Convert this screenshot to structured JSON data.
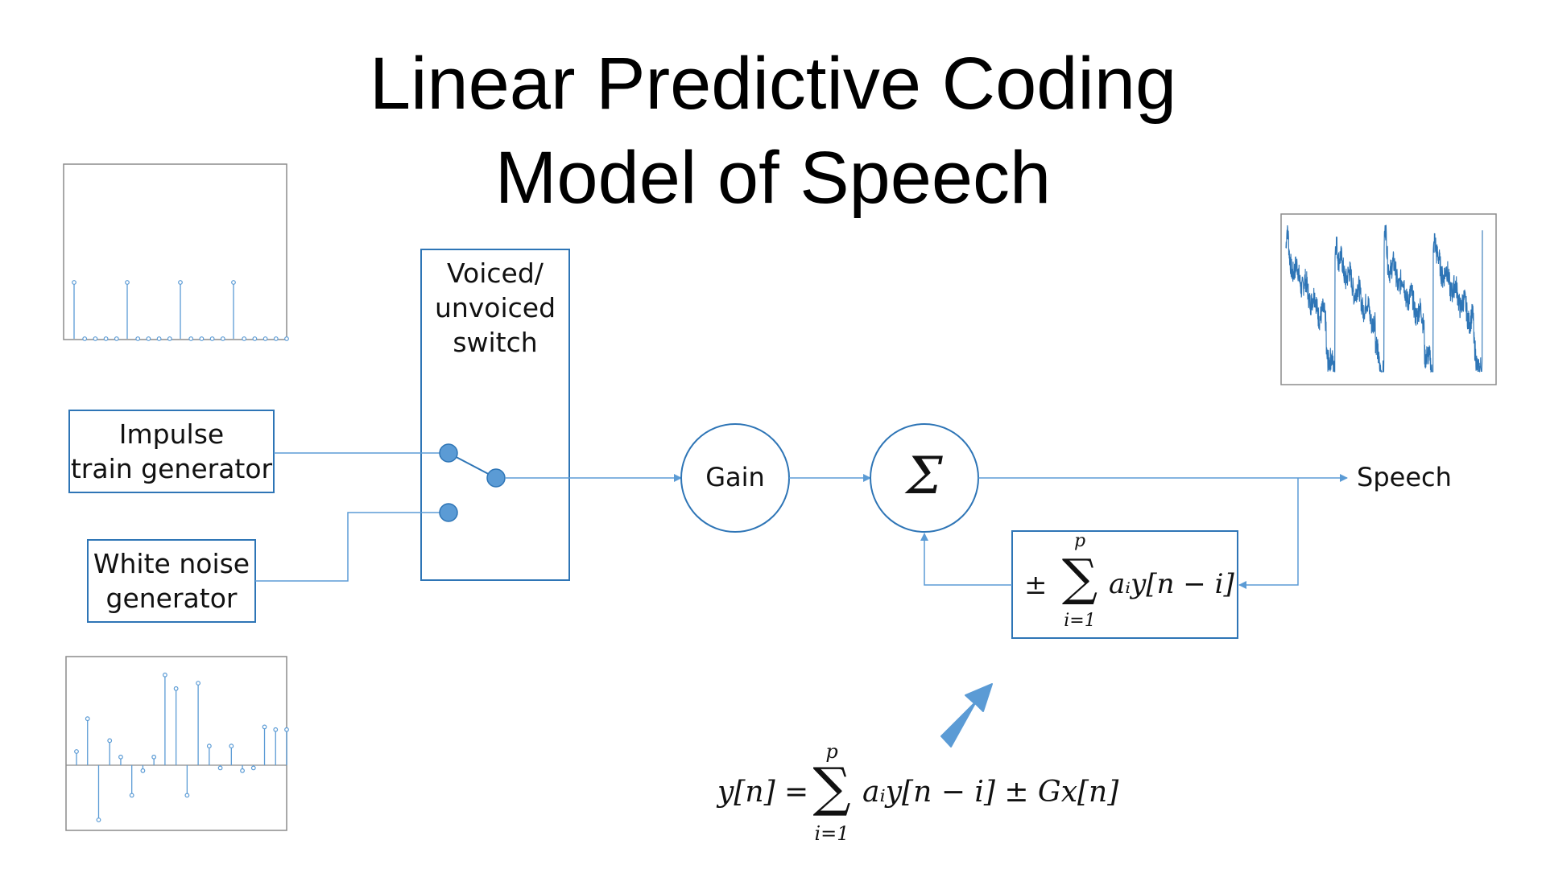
{
  "title": {
    "line1": "Linear Predictive Coding",
    "line2": "Model of Speech"
  },
  "blocks": {
    "impulse": "Impulse train generator",
    "impulse_line1": "Impulse",
    "impulse_line2": "train generator",
    "noise_line1": "White noise",
    "noise_line2": "generator",
    "switch_line1": "Voiced/",
    "switch_line2": "unvoiced",
    "switch_line3": "switch",
    "gain": "Gain",
    "sum_symbol": "Σ",
    "output": "Speech"
  },
  "feedback_formula": {
    "sign": "±",
    "sum_top": "p",
    "sum_bottom": "i=1",
    "body": "aᵢy[n − i]"
  },
  "main_formula": {
    "lhs": "y[n] =",
    "sum_top": "p",
    "sum_bottom": "i=1",
    "rhs": "aᵢy[n − i] ± Gx[n]"
  },
  "colors": {
    "line": "#5b9bd5",
    "node_fill": "#5b9bd5",
    "box_border": "#2e75b6",
    "plot_border": "#8c8c8c",
    "arrow_fill": "#5b9bd5"
  },
  "plots": {
    "impulse_train": {
      "n_samples": 21,
      "impulse_indices": [
        0,
        5,
        10,
        15
      ],
      "impulse_value": 1.0
    },
    "white_noise": {
      "values": [
        0.25,
        0.85,
        -1.0,
        0.45,
        0.15,
        -0.55,
        -0.1,
        0.15,
        1.65,
        1.4,
        -0.55,
        1.5,
        0.35,
        -0.05,
        0.35,
        -0.1,
        -0.05,
        0.7,
        0.65,
        0.65
      ]
    },
    "speech": {
      "n_periods": 4
    }
  }
}
